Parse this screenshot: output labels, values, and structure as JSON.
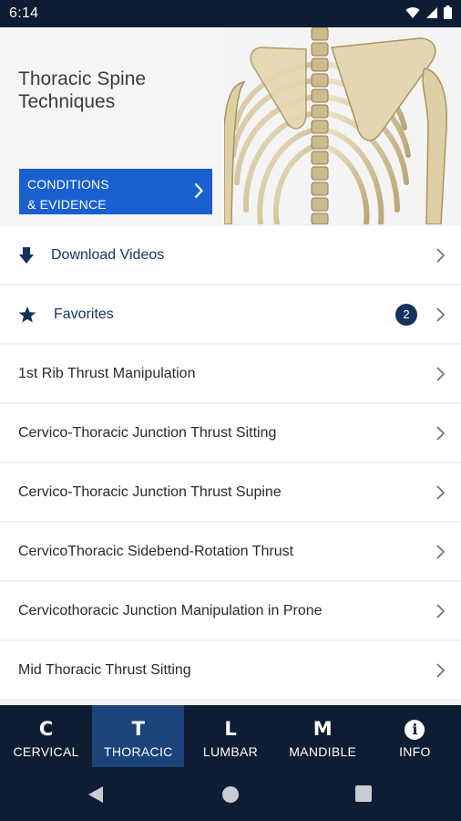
{
  "status": {
    "time": "6:14"
  },
  "header": {
    "title": "Thoracic Spine\nTechniques",
    "conditions_button": "CONDITIONS\n& EVIDENCE"
  },
  "list": {
    "download": {
      "label": "Download Videos",
      "icon": "download-arrow-icon"
    },
    "favorites": {
      "label": "Favorites",
      "count": "2",
      "icon": "star-icon"
    },
    "items": [
      "1st Rib Thrust Manipulation",
      "Cervico-Thoracic Junction Thrust Sitting",
      "Cervico-Thoracic Junction Thrust Supine",
      "CervicoThoracic Sidebend-Rotation Thrust",
      "Cervicothoracic Junction Manipulation in Prone",
      "Mid Thoracic Thrust Sitting"
    ]
  },
  "bottom_nav": [
    {
      "letter": "C",
      "label": "CERVICAL"
    },
    {
      "letter": "T",
      "label": "THORACIC",
      "active": true
    },
    {
      "letter": "L",
      "label": "LUMBAR"
    },
    {
      "letter": "M",
      "label": "MANDIBLE"
    },
    {
      "letter": "i",
      "label": "INFO"
    }
  ],
  "colors": {
    "navy": "#0e1d33",
    "accent_blue": "#1a5fd0",
    "active_tab": "#1c4478",
    "text_blue": "#15325f"
  }
}
